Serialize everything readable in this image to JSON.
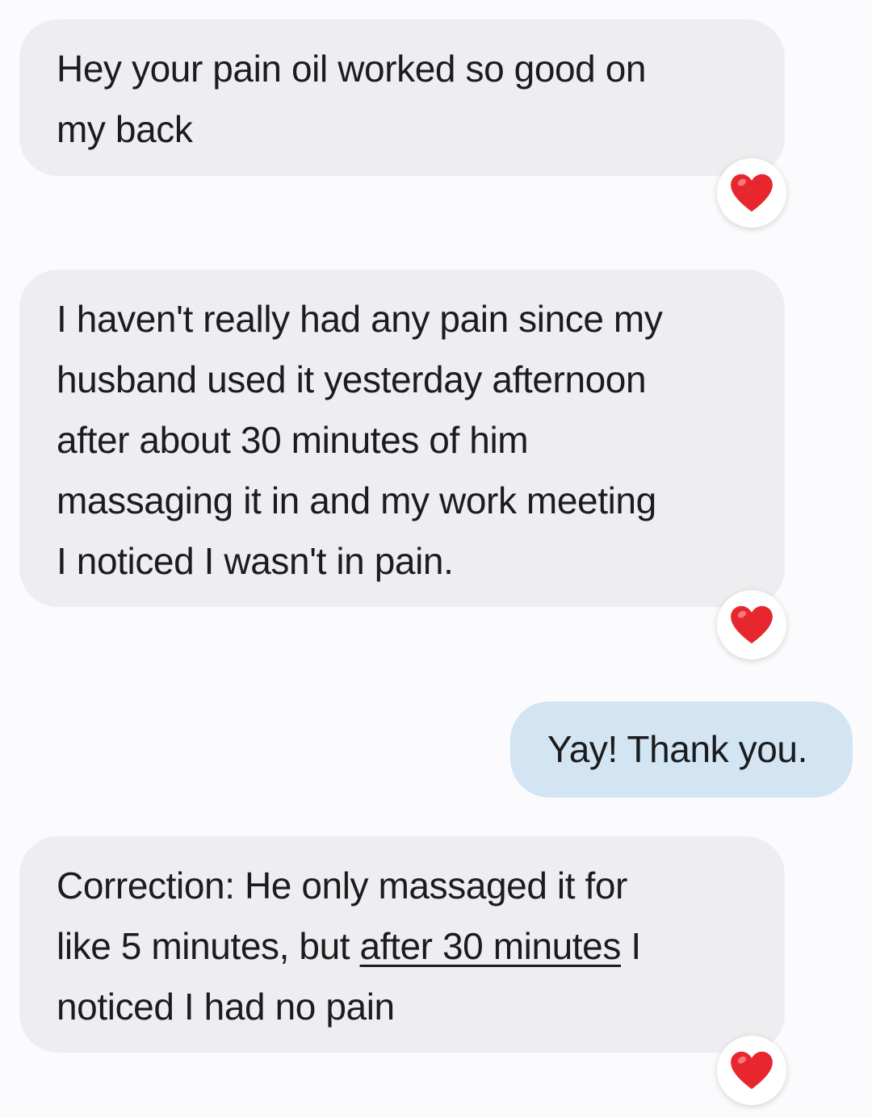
{
  "messages": [
    {
      "direction": "incoming",
      "lines": [
        "Hey your pain oil worked so good on",
        "my back"
      ],
      "reaction": "red-heart-icon"
    },
    {
      "direction": "incoming",
      "lines": [
        "I haven't really had any pain since my",
        "husband used it yesterday afternoon",
        "after about 30 minutes of him",
        "massaging it in and my work meeting",
        "I noticed I wasn't in pain."
      ],
      "reaction": "red-heart-icon"
    },
    {
      "direction": "outgoing",
      "text": "Yay! Thank you."
    },
    {
      "direction": "incoming",
      "line1": "Correction: He only massaged it for",
      "line2_before": "like 5 minutes, but ",
      "line2_underlined": "after 30 minutes",
      "line2_after": " I",
      "line3": "noticed I had no pain",
      "reaction": "red-heart-icon"
    }
  ],
  "colors": {
    "background": "#fbfbfd",
    "incoming_bubble": "#eeeef0",
    "outgoing_bubble": "#d3e4f3",
    "text": "#1c1c1e",
    "heart": "#e8262d"
  }
}
